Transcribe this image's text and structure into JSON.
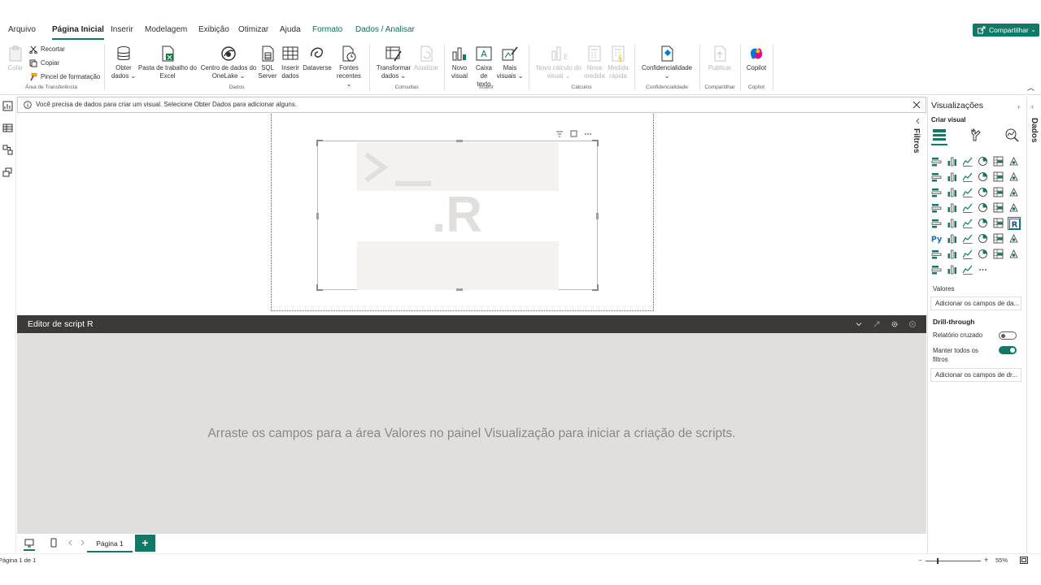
{
  "menu": {
    "tabs": [
      {
        "label": "Arquivo"
      },
      {
        "label": "Página Inicial"
      },
      {
        "label": "Inserir"
      },
      {
        "label": "Modelagem"
      },
      {
        "label": "Exibição"
      },
      {
        "label": "Otimizar"
      },
      {
        "label": "Ajuda"
      },
      {
        "label": "Formato"
      },
      {
        "label": "Dados / Analisar"
      }
    ],
    "share_label": "Compartilhar"
  },
  "ribbon": {
    "clipboard": {
      "paste": "Colar",
      "cut": "Recortar",
      "copy": "Copiar",
      "format_painter": "Pincel de formatação",
      "group": "Área de Transferência"
    },
    "data": {
      "get_data_1": "Obter",
      "get_data_2": "dados",
      "excel_1": "Pasta de trabalho do",
      "excel_2": "Excel",
      "onelake_1": "Centro de dados do",
      "onelake_2": "OneLake",
      "sql_1": "SQL",
      "sql_2": "Server",
      "enter_1": "Inserir",
      "enter_2": "dados",
      "dataverse": "Dataverse",
      "recent_1": "Fontes",
      "recent_2": "recentes",
      "group": "Dados"
    },
    "queries": {
      "transform_1": "Transformar",
      "transform_2": "dados",
      "refresh": "Atualizar",
      "group": "Consultas"
    },
    "insert": {
      "new_visual_1": "Novo",
      "new_visual_2": "visual",
      "textbox_1": "Caixa de",
      "textbox_2": "texto",
      "more_1": "Mais",
      "more_2": "visuais",
      "group": "Inserir"
    },
    "calc": {
      "visual_calc_1": "Novo cálculo do",
      "visual_calc_2": "visual",
      "measure_1": "Nova",
      "measure_2": "medida",
      "quick_1": "Medida",
      "quick_2": "rápida",
      "group": "Cálculos"
    },
    "sensitivity": {
      "label": "Confidencialidade",
      "group": "Confidencialidade"
    },
    "share": {
      "publish": "Publicar",
      "group": "Compartilhar"
    },
    "copilot": {
      "label": "Copilot",
      "group": "Copilot"
    }
  },
  "infobar": {
    "message": "Você precisa de dados para criar um visual. Selecione Obter Dados para adicionar alguns."
  },
  "canvas": {
    "r_mark": ".R",
    "filters_label": "Filtros"
  },
  "editor": {
    "title": "Editor de script R",
    "hint": "Arraste os campos para a área Valores no painel Visualização para iniciar a criação de scripts."
  },
  "pages": {
    "tab_label": "Página 1",
    "add": "+"
  },
  "status": {
    "page_info": "Página 1 de 1",
    "zoom": "55%"
  },
  "viz_pane": {
    "title": "Visualizações",
    "build_label": "Criar visual",
    "values_label": "Valores",
    "values_well": "Adicionar os campos de da...",
    "drill_label": "Drill-through",
    "cross_report": "Relatório cruzado",
    "keep_filters": "Manter todos os filtros",
    "drill_well": "Adicionar os campos de dr...",
    "cross_report_on": false,
    "keep_filters_on": true
  },
  "data_pane": {
    "label": "Dados"
  },
  "colors": {
    "accent": "#117865",
    "editor_header": "#3b3a39",
    "editor_body": "#e1dfdd"
  }
}
